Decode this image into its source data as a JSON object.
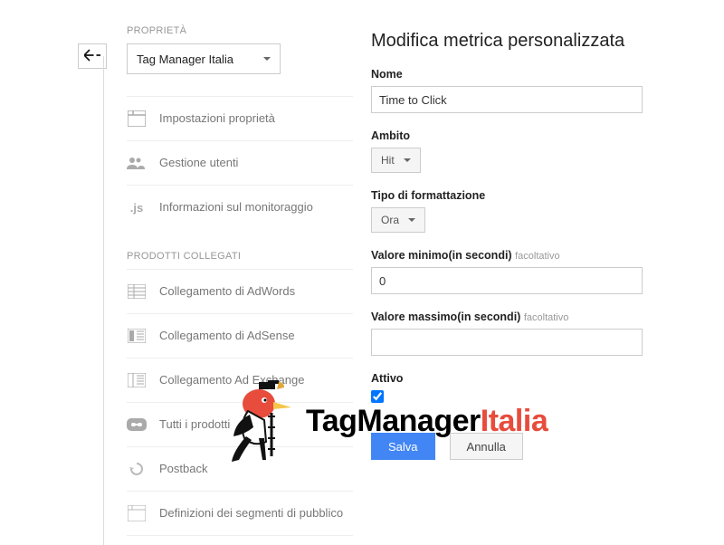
{
  "back_icon": "back",
  "sidebar": {
    "section_label": "PROPRIETÀ",
    "property_select": "Tag Manager Italia",
    "items": [
      {
        "label": "Impostazioni proprietà"
      },
      {
        "label": "Gestione utenti"
      },
      {
        "label": "Informazioni sul monitoraggio"
      }
    ],
    "linked_label": "PRODOTTI COLLEGATI",
    "linked_items": [
      {
        "label": "Collegamento di AdWords"
      },
      {
        "label": "Collegamento di AdSense"
      },
      {
        "label": "Collegamento Ad Exchange"
      },
      {
        "label": "Tutti i prodotti"
      },
      {
        "label": "Postback"
      },
      {
        "label": "Definizioni dei segmenti di pubblico"
      }
    ]
  },
  "main": {
    "title": "Modifica metrica personalizzata",
    "name_label": "Nome",
    "name_value": "Time to Click",
    "scope_label": "Ambito",
    "scope_value": "Hit",
    "format_label": "Tipo di formattazione",
    "format_value": "Ora",
    "min_label": "Valore minimo(in secondi)",
    "optional": "facoltativo",
    "min_value": "0",
    "max_label": "Valore massimo(in secondi)",
    "max_value": "",
    "active_label": "Attivo",
    "active_checked": true,
    "save": "Salva",
    "cancel": "Annulla"
  },
  "watermark": {
    "t1": "TagManager",
    "t2": "Italia"
  }
}
